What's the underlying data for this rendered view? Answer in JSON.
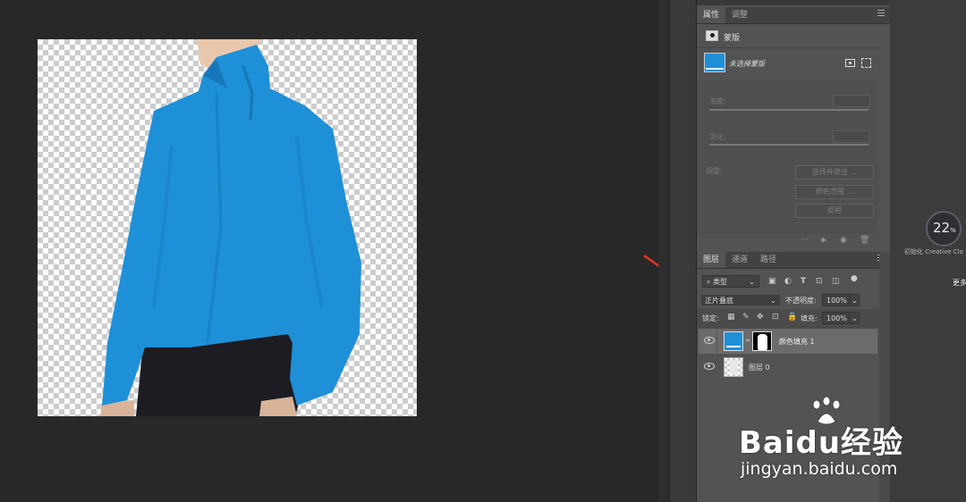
{
  "properties_panel": {
    "tabs": [
      "属性",
      "调整"
    ],
    "section_title": "蒙版",
    "mask_status": "未选择蒙版",
    "density_label": "浓度:",
    "feather_label": "羽化:",
    "adjust_label": "调整:",
    "buttons": [
      "选择并遮住 ...",
      "颜色范围 ...",
      "反相"
    ]
  },
  "layers_panel": {
    "tabs": [
      "图层",
      "通道",
      "路径"
    ],
    "filter_type": "类型",
    "blend_mode": "正片叠底",
    "opacity_label": "不透明度:",
    "opacity_value": "100%",
    "lock_label": "锁定:",
    "fill_label": "填充:",
    "fill_value": "100%",
    "layers": [
      {
        "name": "颜色填充 1",
        "visible": true,
        "selected": true
      },
      {
        "name": "图层 0",
        "visible": true,
        "selected": false
      }
    ]
  },
  "sync_widget": {
    "percent": "22",
    "percent_unit": "%",
    "status_text": "初始化 Creative Clo",
    "more_text": "更多"
  },
  "watermark": {
    "brand": "Baidu经验",
    "url": "jingyan.baidu.com"
  },
  "colors": {
    "fill_color": "#1e90d8",
    "annotation_arrow": "#e5332a"
  }
}
